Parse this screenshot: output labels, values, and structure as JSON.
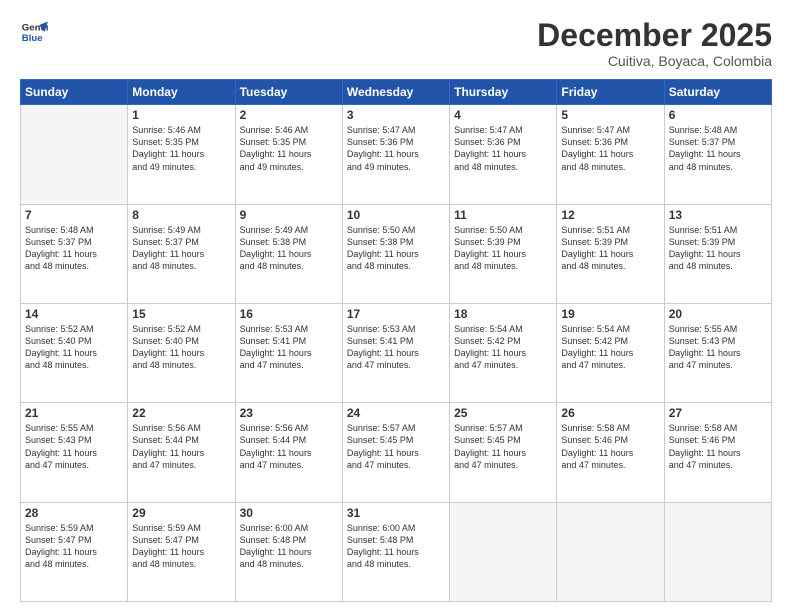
{
  "header": {
    "logo_line1": "General",
    "logo_line2": "Blue",
    "month": "December 2025",
    "location": "Cuitiva, Boyaca, Colombia"
  },
  "weekdays": [
    "Sunday",
    "Monday",
    "Tuesday",
    "Wednesday",
    "Thursday",
    "Friday",
    "Saturday"
  ],
  "weeks": [
    [
      {
        "day": "",
        "text": ""
      },
      {
        "day": "1",
        "text": "Sunrise: 5:46 AM\nSunset: 5:35 PM\nDaylight: 11 hours\nand 49 minutes."
      },
      {
        "day": "2",
        "text": "Sunrise: 5:46 AM\nSunset: 5:35 PM\nDaylight: 11 hours\nand 49 minutes."
      },
      {
        "day": "3",
        "text": "Sunrise: 5:47 AM\nSunset: 5:36 PM\nDaylight: 11 hours\nand 49 minutes."
      },
      {
        "day": "4",
        "text": "Sunrise: 5:47 AM\nSunset: 5:36 PM\nDaylight: 11 hours\nand 48 minutes."
      },
      {
        "day": "5",
        "text": "Sunrise: 5:47 AM\nSunset: 5:36 PM\nDaylight: 11 hours\nand 48 minutes."
      },
      {
        "day": "6",
        "text": "Sunrise: 5:48 AM\nSunset: 5:37 PM\nDaylight: 11 hours\nand 48 minutes."
      }
    ],
    [
      {
        "day": "7",
        "text": "Sunrise: 5:48 AM\nSunset: 5:37 PM\nDaylight: 11 hours\nand 48 minutes."
      },
      {
        "day": "8",
        "text": "Sunrise: 5:49 AM\nSunset: 5:37 PM\nDaylight: 11 hours\nand 48 minutes."
      },
      {
        "day": "9",
        "text": "Sunrise: 5:49 AM\nSunset: 5:38 PM\nDaylight: 11 hours\nand 48 minutes."
      },
      {
        "day": "10",
        "text": "Sunrise: 5:50 AM\nSunset: 5:38 PM\nDaylight: 11 hours\nand 48 minutes."
      },
      {
        "day": "11",
        "text": "Sunrise: 5:50 AM\nSunset: 5:39 PM\nDaylight: 11 hours\nand 48 minutes."
      },
      {
        "day": "12",
        "text": "Sunrise: 5:51 AM\nSunset: 5:39 PM\nDaylight: 11 hours\nand 48 minutes."
      },
      {
        "day": "13",
        "text": "Sunrise: 5:51 AM\nSunset: 5:39 PM\nDaylight: 11 hours\nand 48 minutes."
      }
    ],
    [
      {
        "day": "14",
        "text": "Sunrise: 5:52 AM\nSunset: 5:40 PM\nDaylight: 11 hours\nand 48 minutes."
      },
      {
        "day": "15",
        "text": "Sunrise: 5:52 AM\nSunset: 5:40 PM\nDaylight: 11 hours\nand 48 minutes."
      },
      {
        "day": "16",
        "text": "Sunrise: 5:53 AM\nSunset: 5:41 PM\nDaylight: 11 hours\nand 47 minutes."
      },
      {
        "day": "17",
        "text": "Sunrise: 5:53 AM\nSunset: 5:41 PM\nDaylight: 11 hours\nand 47 minutes."
      },
      {
        "day": "18",
        "text": "Sunrise: 5:54 AM\nSunset: 5:42 PM\nDaylight: 11 hours\nand 47 minutes."
      },
      {
        "day": "19",
        "text": "Sunrise: 5:54 AM\nSunset: 5:42 PM\nDaylight: 11 hours\nand 47 minutes."
      },
      {
        "day": "20",
        "text": "Sunrise: 5:55 AM\nSunset: 5:43 PM\nDaylight: 11 hours\nand 47 minutes."
      }
    ],
    [
      {
        "day": "21",
        "text": "Sunrise: 5:55 AM\nSunset: 5:43 PM\nDaylight: 11 hours\nand 47 minutes."
      },
      {
        "day": "22",
        "text": "Sunrise: 5:56 AM\nSunset: 5:44 PM\nDaylight: 11 hours\nand 47 minutes."
      },
      {
        "day": "23",
        "text": "Sunrise: 5:56 AM\nSunset: 5:44 PM\nDaylight: 11 hours\nand 47 minutes."
      },
      {
        "day": "24",
        "text": "Sunrise: 5:57 AM\nSunset: 5:45 PM\nDaylight: 11 hours\nand 47 minutes."
      },
      {
        "day": "25",
        "text": "Sunrise: 5:57 AM\nSunset: 5:45 PM\nDaylight: 11 hours\nand 47 minutes."
      },
      {
        "day": "26",
        "text": "Sunrise: 5:58 AM\nSunset: 5:46 PM\nDaylight: 11 hours\nand 47 minutes."
      },
      {
        "day": "27",
        "text": "Sunrise: 5:58 AM\nSunset: 5:46 PM\nDaylight: 11 hours\nand 47 minutes."
      }
    ],
    [
      {
        "day": "28",
        "text": "Sunrise: 5:59 AM\nSunset: 5:47 PM\nDaylight: 11 hours\nand 48 minutes."
      },
      {
        "day": "29",
        "text": "Sunrise: 5:59 AM\nSunset: 5:47 PM\nDaylight: 11 hours\nand 48 minutes."
      },
      {
        "day": "30",
        "text": "Sunrise: 6:00 AM\nSunset: 5:48 PM\nDaylight: 11 hours\nand 48 minutes."
      },
      {
        "day": "31",
        "text": "Sunrise: 6:00 AM\nSunset: 5:48 PM\nDaylight: 11 hours\nand 48 minutes."
      },
      {
        "day": "",
        "text": ""
      },
      {
        "day": "",
        "text": ""
      },
      {
        "day": "",
        "text": ""
      }
    ]
  ]
}
